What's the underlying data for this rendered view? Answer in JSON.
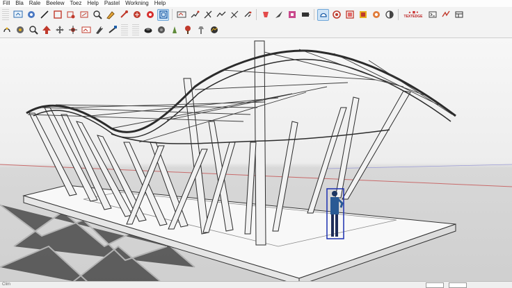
{
  "menubar": {
    "items": [
      "Fill",
      "Bla",
      "Rale",
      "Beelew",
      "Toez",
      "Help",
      "Pastel",
      "Workning",
      "Help"
    ]
  },
  "toolbar1": {
    "icons": [
      "select-icon",
      "eraser-icon",
      "line-icon",
      "rectangle-icon",
      "circle-icon",
      "shape-icon",
      "magnify-icon",
      "paint-icon",
      "push-pull-icon",
      "move-icon",
      "rotate-icon",
      "offset-icon",
      "camera-icon",
      "walk-icon",
      "axes-icon",
      "tape-icon",
      "protractor-icon",
      "text-icon",
      "dimension-icon",
      "section-icon",
      "component-icon",
      "group-icon",
      "model-info-icon",
      "warehouse-icon",
      "extension-icon",
      "layers-icon",
      "styles-icon",
      "shadow-icon",
      "fog-icon",
      "scene-icon",
      "layout-icon"
    ],
    "badge_text": "TEXTEDGE"
  },
  "toolbar2": {
    "icons": [
      "lasso-icon",
      "color-icon",
      "zoom-extents-icon",
      "arrow-up-icon",
      "pan-icon",
      "orbit-icon",
      "image-icon",
      "tag-icon",
      "flatten-icon",
      "sphere-icon",
      "surface-icon",
      "bulb-icon",
      "tree-icon",
      "lamp-icon",
      "terrain-icon"
    ]
  },
  "status": {
    "hint": "Clim"
  }
}
